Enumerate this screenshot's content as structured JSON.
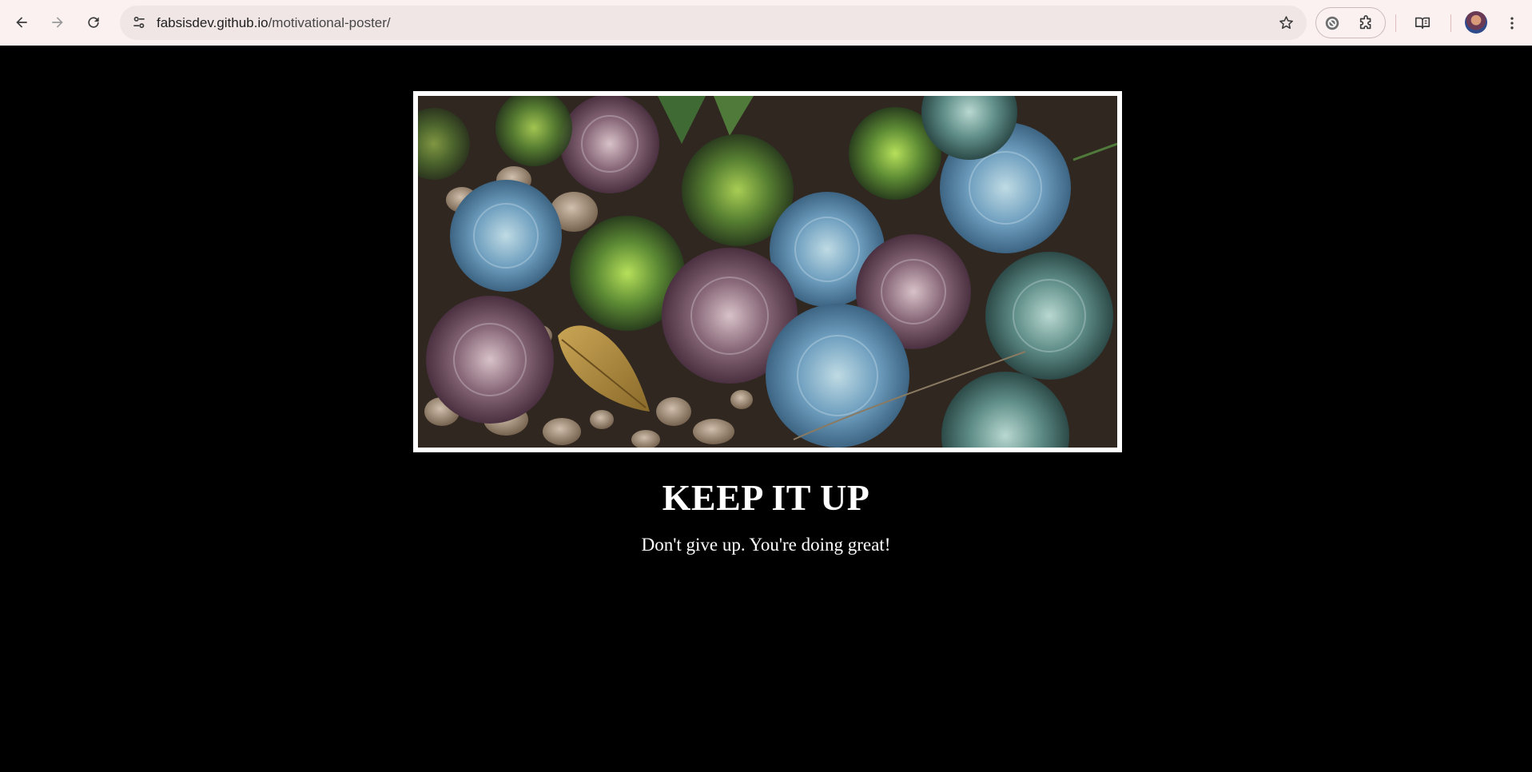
{
  "browser": {
    "url_domain": "fabsisdev.github.io",
    "url_path": "/motivational-poster/",
    "icons": {
      "back": "arrow-left-icon",
      "forward": "arrow-right-icon",
      "reload": "reload-icon",
      "site_info": "tune-icon",
      "bookmark": "star-icon",
      "extension_a": "blocked-circle-icon",
      "extensions": "puzzle-icon",
      "reading_mode": "book-icon",
      "profile": "avatar",
      "menu": "kebab-menu-icon"
    }
  },
  "poster": {
    "image_subject": "succulents",
    "title": "KEEP IT UP",
    "subtitle": "Don't give up. You're doing great!"
  },
  "colors": {
    "page_background": "#000000",
    "text": "#ffffff",
    "frame": "#ffffff",
    "chrome_background": "#fbf1f1"
  }
}
